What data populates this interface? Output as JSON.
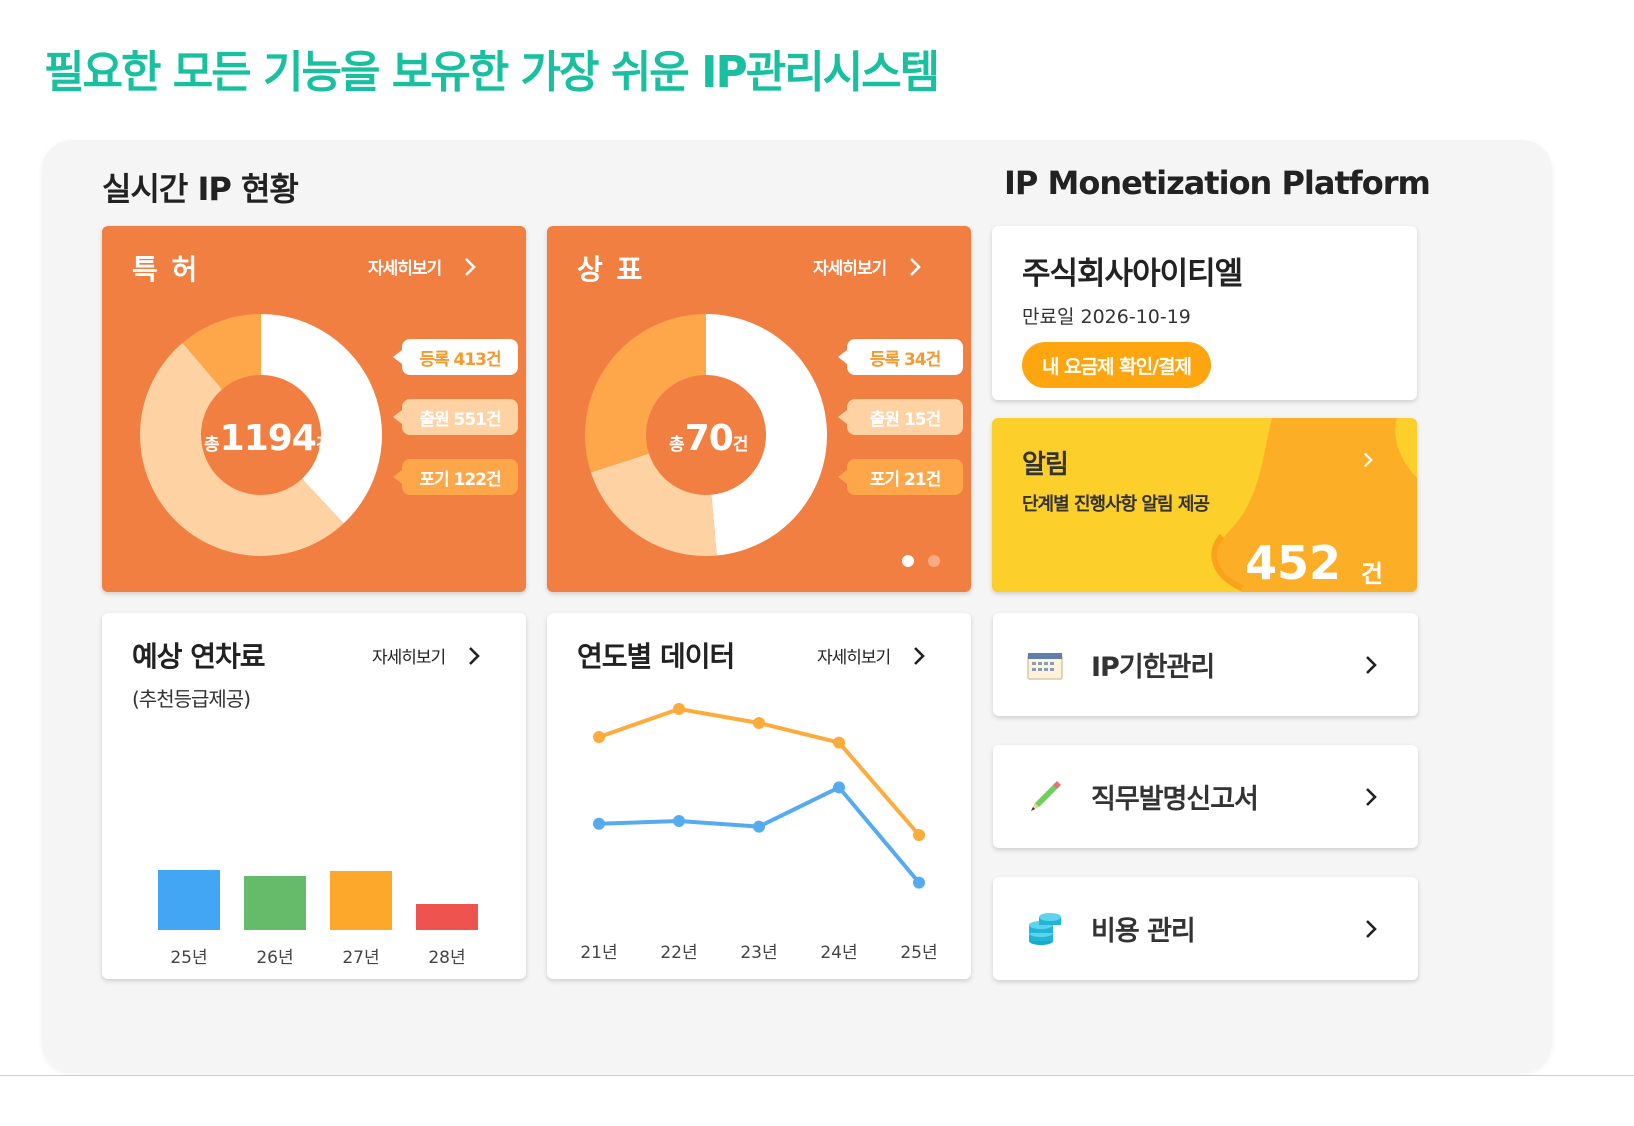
{
  "headline": "필요한 모든 기능을 보유한 가장 쉬운 IP관리시스템",
  "sections": {
    "left_title": "실시간 IP 현황",
    "right_title": "IP Monetization Platform"
  },
  "patent": {
    "title": "특 허",
    "more": "자세히보기",
    "total_prefix": "총",
    "total": "1194",
    "total_unit": "건",
    "stats": [
      {
        "label": "등록 413건",
        "value": 413
      },
      {
        "label": "출원 551건",
        "value": 551
      },
      {
        "label": "포기 122건",
        "value": 122
      }
    ]
  },
  "trademark": {
    "title": "상 표",
    "more": "자세히보기",
    "total_prefix": "총",
    "total": "70",
    "total_unit": "건",
    "stats": [
      {
        "label": "등록 34건",
        "value": 34
      },
      {
        "label": "출원 15건",
        "value": 15
      },
      {
        "label": "포기 21건",
        "value": 21
      }
    ]
  },
  "colors": {
    "registered": "#ffffff",
    "applied": "#ffd2a4",
    "abandoned": "#fda64a",
    "card_orange": "#f07f41",
    "headline": "#18c0a0"
  },
  "company": {
    "name": "주식회사아이티엘",
    "expire": "만료일 2026-10-19",
    "plan_button": "내 요금제 확인/결제"
  },
  "alarm": {
    "title": "알림",
    "subtitle": "단계별 진행사항 알림 제공",
    "count": "452",
    "unit": "건"
  },
  "menus": [
    {
      "label": "IP기한관리",
      "icon": "calendar-icon"
    },
    {
      "label": "직무발명신고서",
      "icon": "pencil-icon"
    },
    {
      "label": "비용 관리",
      "icon": "coins-icon"
    }
  ],
  "fee": {
    "title": "예상 연차료",
    "subtitle": "(추천등급제공)",
    "more": "자세히보기"
  },
  "yearly": {
    "title": "연도별 데이터",
    "more": "자세히보기"
  },
  "chart_data": [
    {
      "type": "bar",
      "categories": [
        "25년",
        "26년",
        "27년",
        "28년"
      ],
      "values": [
        60,
        54,
        59,
        26
      ],
      "colors": [
        "#43a6f5",
        "#66bb6a",
        "#fda82a",
        "#ef5350"
      ]
    },
    {
      "type": "line",
      "x": [
        "21년",
        "22년",
        "23년",
        "24년",
        "25년"
      ],
      "series": [
        {
          "values": [
            70,
            80,
            75,
            68,
            35
          ],
          "color": "#fdab3c"
        },
        {
          "values": [
            39,
            40,
            38,
            52,
            18
          ],
          "color": "#56aaf0"
        }
      ]
    }
  ]
}
